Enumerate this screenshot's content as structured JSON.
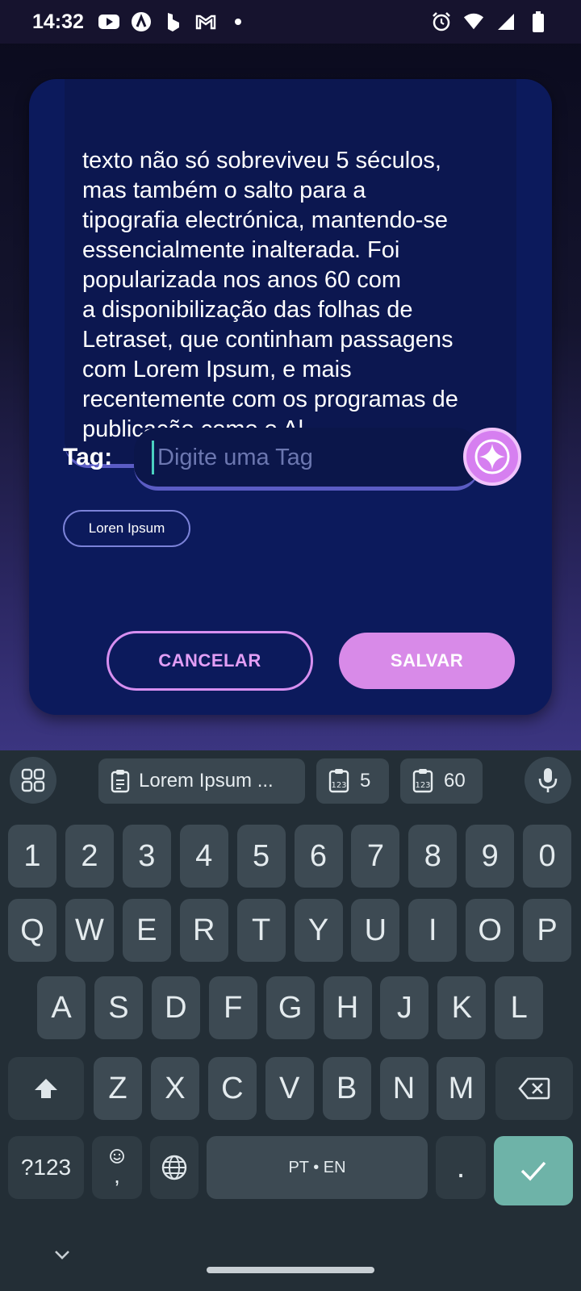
{
  "status_bar": {
    "time": "14:32",
    "left_icons": [
      "youtube-icon",
      "arc-icon",
      "bing-icon",
      "gmail-icon",
      "dot-icon"
    ],
    "right_icons": [
      "alarm-icon",
      "wifi-icon",
      "signal-icon",
      "battery-icon"
    ]
  },
  "dialog": {
    "text_content": "texto não só sobreviveu 5 séculos,\nmas também o salto para a\ntipografia electrónica, mantendo-se\nessencialmente inalterada. Foi\npopularizada nos anos 60 com\na disponibilização das folhas de\nLetraset, que continham passagens\ncom Lorem Ipsum, e mais\nrecentemente com os programas de\npublicação como o Al",
    "tag_label": "Tag:",
    "tag_placeholder": "Digite uma Tag",
    "tag_value": "",
    "chips": [
      "Loren Ipsum"
    ],
    "cancel_label": "CANCELAR",
    "save_label": "SALVAR"
  },
  "keyboard": {
    "suggestions": [
      {
        "label": "Lorem Ipsum ...",
        "icon": "clipboard-icon"
      },
      {
        "label": "5",
        "icon": "clipboard-number-icon"
      },
      {
        "label": "60",
        "icon": "clipboard-number-icon"
      }
    ],
    "row_numbers": [
      "1",
      "2",
      "3",
      "4",
      "5",
      "6",
      "7",
      "8",
      "9",
      "0"
    ],
    "row_q": [
      "Q",
      "W",
      "E",
      "R",
      "T",
      "Y",
      "U",
      "I",
      "O",
      "P"
    ],
    "row_a": [
      "A",
      "S",
      "D",
      "F",
      "G",
      "H",
      "J",
      "K",
      "L"
    ],
    "row_z": [
      "Z",
      "X",
      "C",
      "V",
      "B",
      "N",
      "M"
    ],
    "symbols_label": "?123",
    "comma_label": ",",
    "space_label": "PT • EN",
    "period_label": ".",
    "colors": {
      "background": "#232e36",
      "key": "#3d4a53",
      "enter": "#6eb3a8"
    }
  },
  "colors": {
    "dialog": "#0c1a5c",
    "accent": "#d88ae8",
    "chip_border": "#7b82d8"
  }
}
